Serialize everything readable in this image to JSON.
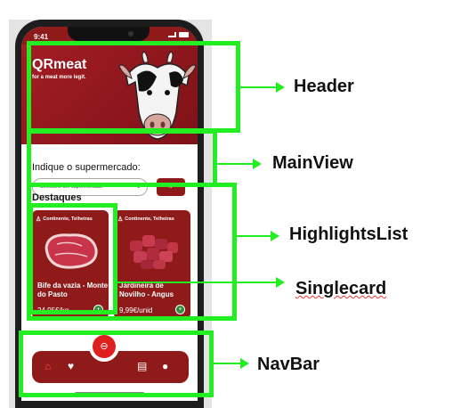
{
  "status_bar": {
    "time": "9:41"
  },
  "header": {
    "brand": "QRmeat",
    "tagline": "for a meat more legit."
  },
  "main_view": {
    "prompt": "Indique o supermercado:",
    "select_placeholder": "Selecione um supermercado",
    "go_button": "Ir"
  },
  "highlights": {
    "title": "Destaques",
    "cards": [
      {
        "store": "Continente, Telheiras",
        "name": "Bife da vazia - Monte do Pasto",
        "price": "24,95€/kg"
      },
      {
        "store": "Continente, Telheiras",
        "name": "Jardineira de Novilho - Angus",
        "price": "9,99€/unid"
      }
    ]
  },
  "navbar": {
    "icons": [
      "home-icon",
      "heart-icon",
      "scan-icon",
      "news-icon",
      "user-icon"
    ]
  },
  "annotations": {
    "header": "Header",
    "main_view": "MainView",
    "highlights_list": "HighlightsList",
    "single_card": "Singlecard",
    "nav_bar": "NavBar"
  },
  "colors": {
    "brand_red": "#8e1a1a",
    "annotation_green": "#22ee22",
    "scan_red": "#e01f1f"
  }
}
